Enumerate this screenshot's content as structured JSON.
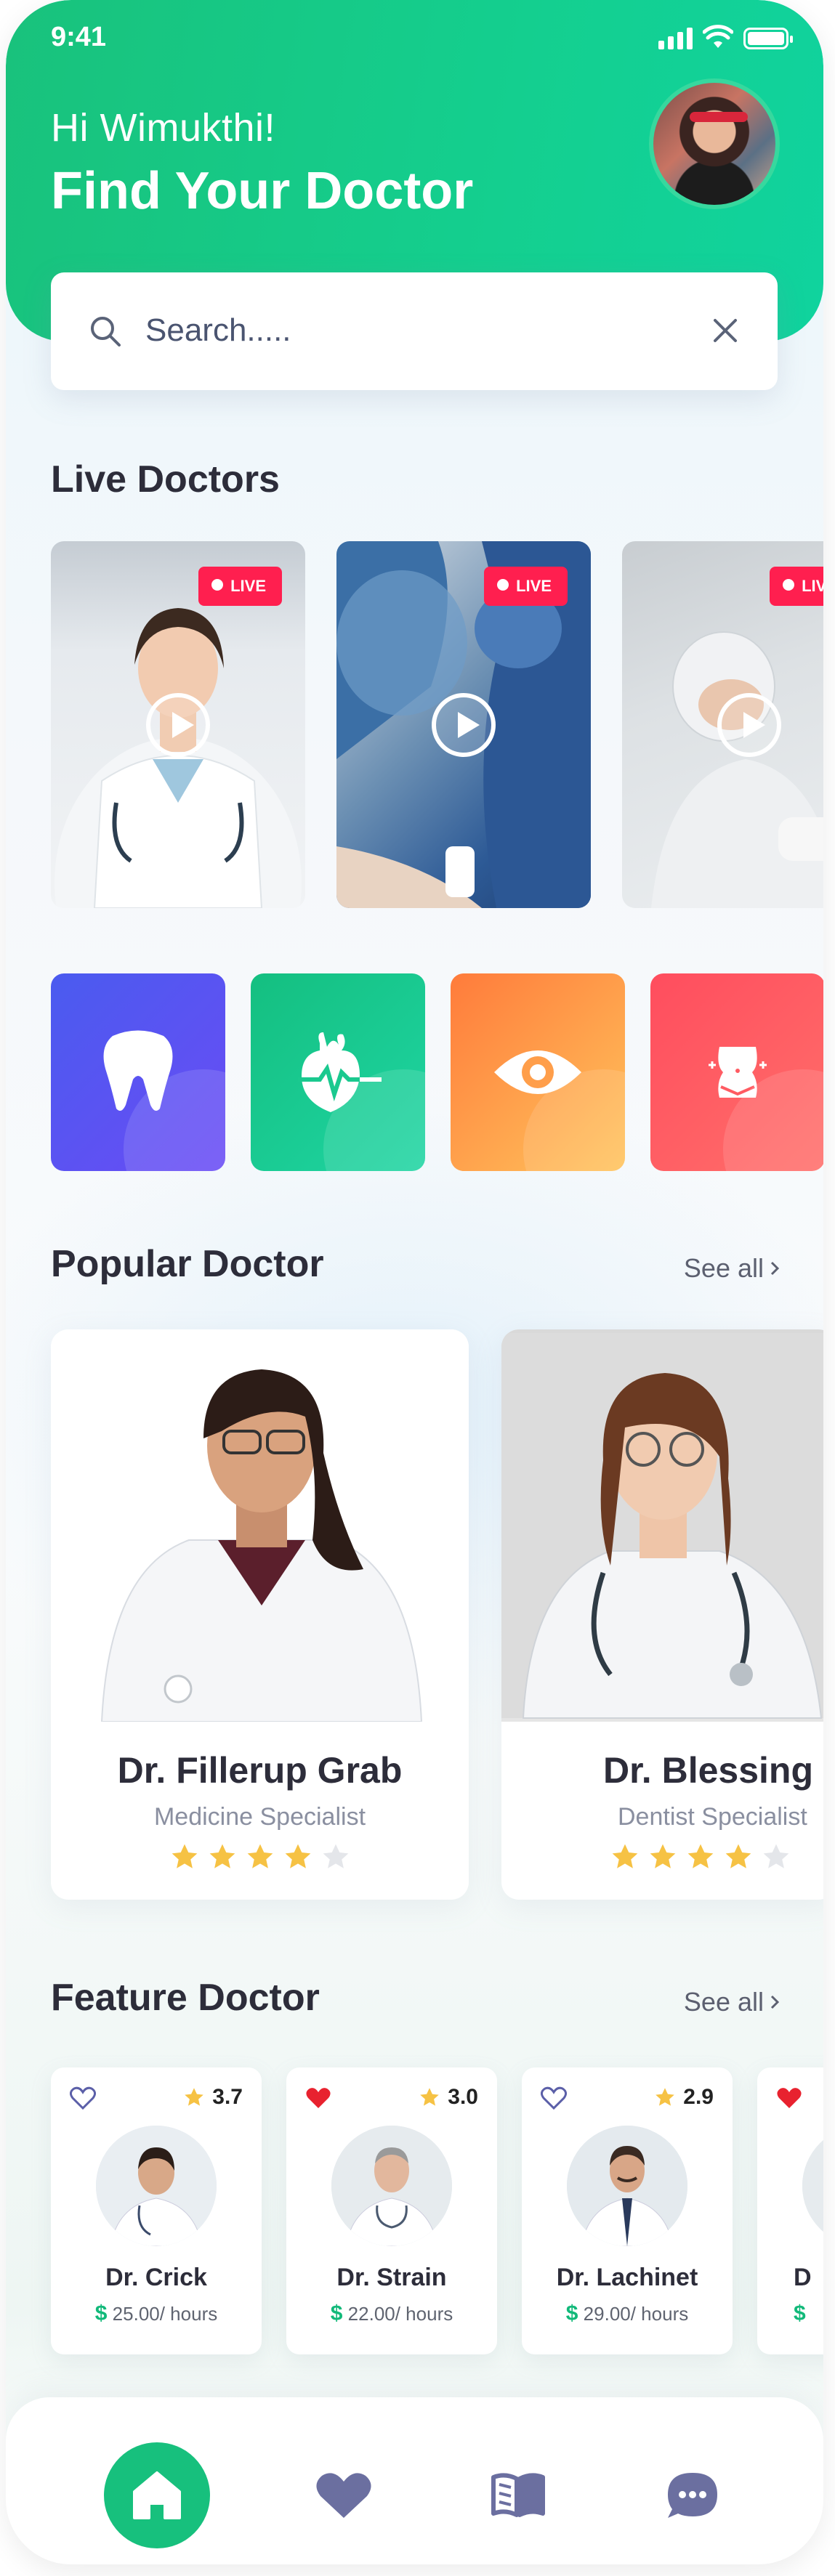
{
  "status_bar": {
    "time": "9:41"
  },
  "header": {
    "greeting": "Hi Wimukthi!",
    "title": "Find Your Doctor"
  },
  "search": {
    "placeholder": "Search....."
  },
  "live_doctors": {
    "title": "Live Doctors",
    "badge": "LIVE",
    "cards": [
      {
        "badge": "LIVE"
      },
      {
        "badge": "LIVE"
      },
      {
        "badge": "LIVE"
      }
    ]
  },
  "categories": [
    {
      "icon": "tooth-icon",
      "color": "#4a5bef"
    },
    {
      "icon": "heart-organ-icon",
      "color": "#14bf80"
    },
    {
      "icon": "eye-icon",
      "color": "#ff7b3b"
    },
    {
      "icon": "body-icon",
      "color": "#ff4d5e"
    }
  ],
  "popular_doctor": {
    "title": "Popular Doctor",
    "see_all": "See all",
    "doctors": [
      {
        "name": "Dr. Fillerup Grab",
        "specialty": "Medicine Specialist",
        "stars": 4
      },
      {
        "name": "Dr. Blessing",
        "specialty": "Dentist Specialist",
        "stars": 4
      }
    ]
  },
  "feature_doctor": {
    "title": "Feature Doctor",
    "see_all": "See all",
    "doctors": [
      {
        "name": "Dr. Crick",
        "rating": "3.7",
        "price": "25.00/ hours",
        "currency": "$",
        "favorite": false
      },
      {
        "name": "Dr. Strain",
        "rating": "3.0",
        "price": "22.00/ hours",
        "currency": "$",
        "favorite": true
      },
      {
        "name": "Dr. Lachinet",
        "rating": "2.9",
        "price": "29.00/ hours",
        "currency": "$",
        "favorite": false
      },
      {
        "name": "D",
        "rating": "",
        "price": "",
        "currency": "$",
        "favorite": true
      }
    ]
  },
  "bottom_nav": {
    "items": [
      "home-icon",
      "heart-icon",
      "book-icon",
      "chat-icon"
    ]
  },
  "colors": {
    "primary": "#17c07d",
    "live": "#ff1f4f",
    "star": "#f6c244",
    "heart_red": "#e8222f"
  }
}
